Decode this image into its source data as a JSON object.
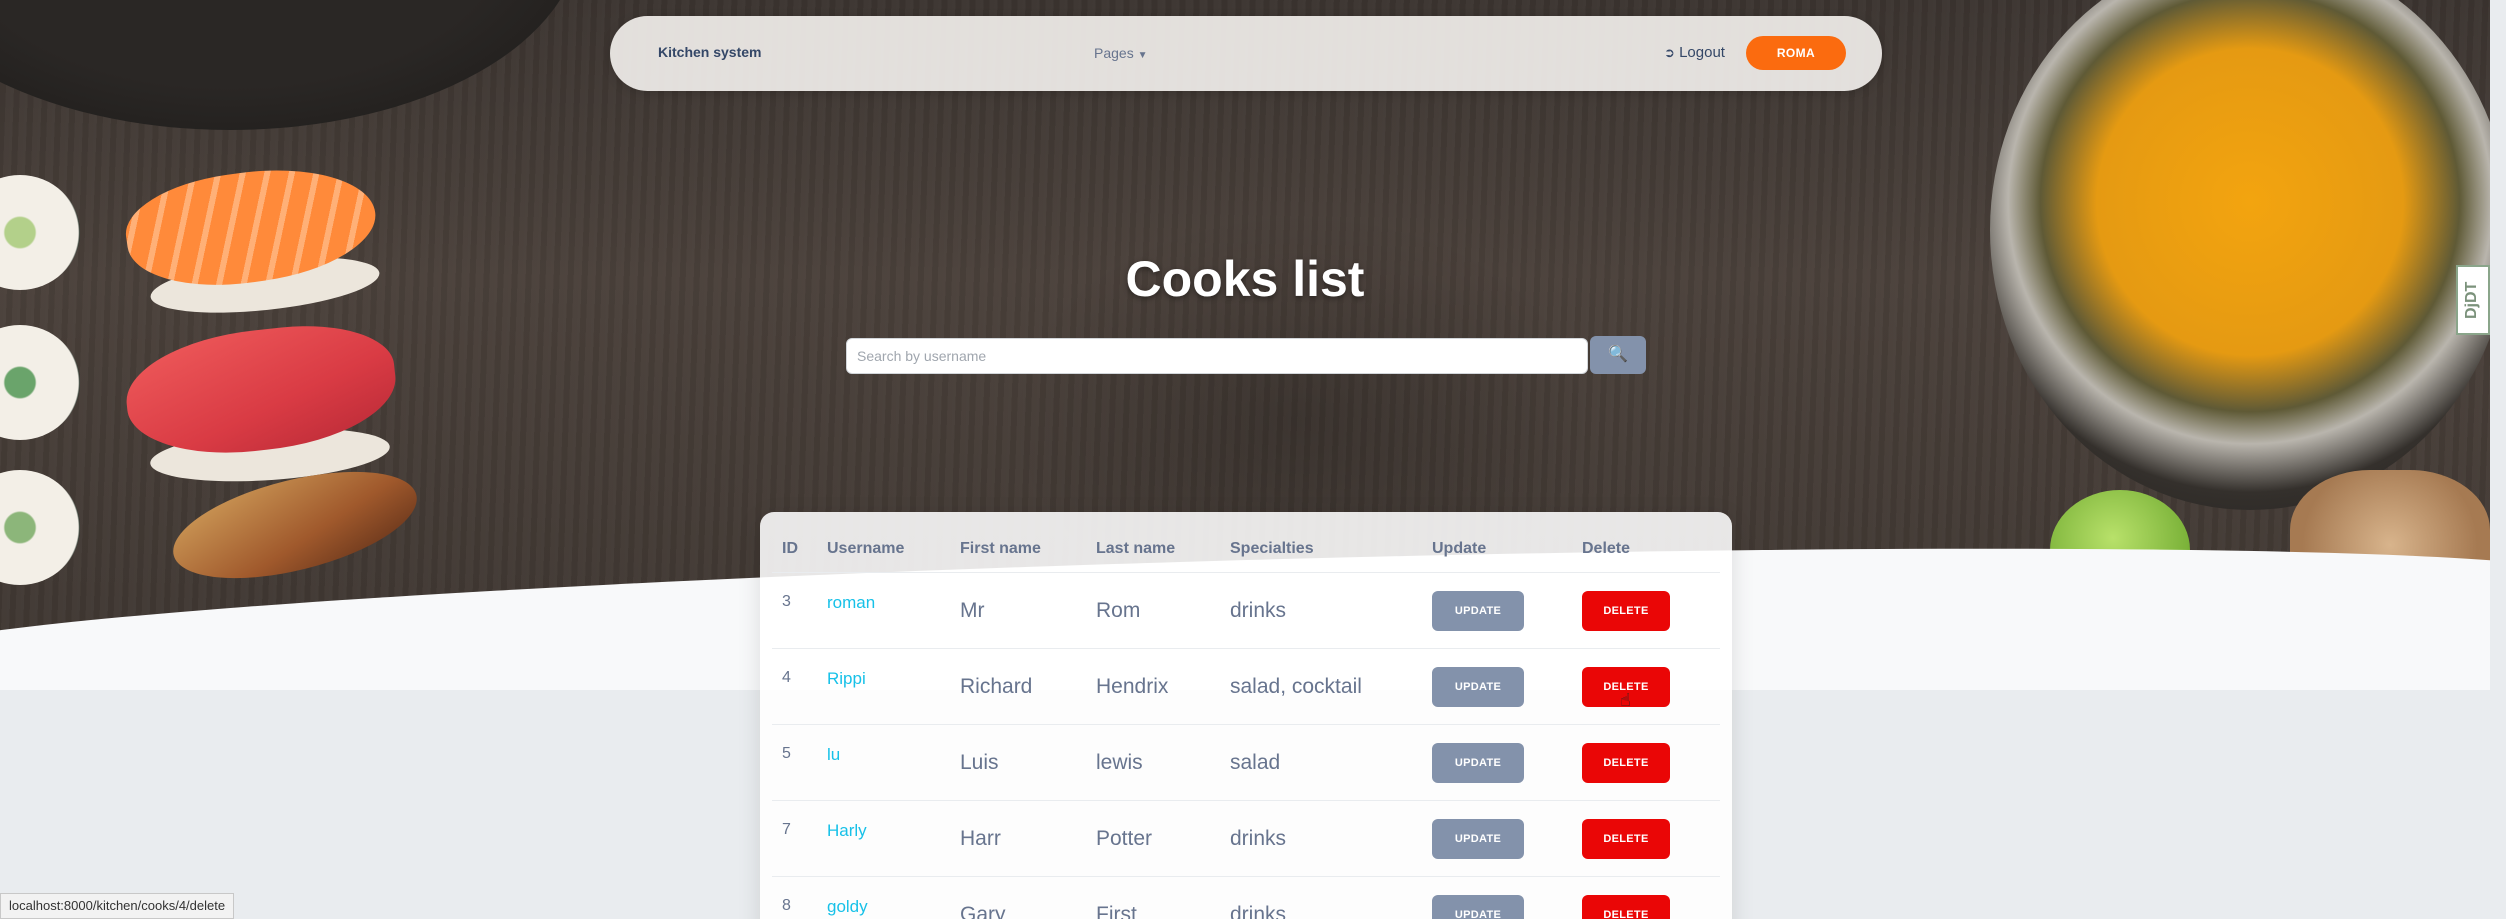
{
  "navbar": {
    "brand": "Kitchen system",
    "pages_label": "Pages",
    "logout_label": "Logout",
    "user_label": "ROMA",
    "accent_color": "#fb6b0f"
  },
  "page": {
    "title": "Cooks list",
    "search_placeholder": "Search by username",
    "search_icon": "magnifier-icon"
  },
  "table": {
    "headers": [
      "ID",
      "Username",
      "First name",
      "Last name",
      "Specialties",
      "Update",
      "Delete"
    ],
    "rows": [
      {
        "id": "3",
        "username": "roman",
        "first_name": "Mr",
        "last_name": "Rom",
        "specialties": "drinks",
        "update": "UPDATE",
        "delete": "DELETE"
      },
      {
        "id": "4",
        "username": "Rippi",
        "first_name": "Richard",
        "last_name": "Hendrix",
        "specialties": "salad, cocktail",
        "update": "UPDATE",
        "delete": "DELETE"
      },
      {
        "id": "5",
        "username": "lu",
        "first_name": "Luis",
        "last_name": "lewis",
        "specialties": "salad",
        "update": "UPDATE",
        "delete": "DELETE"
      },
      {
        "id": "7",
        "username": "Harly",
        "first_name": "Harr",
        "last_name": "Potter",
        "specialties": "drinks",
        "update": "UPDATE",
        "delete": "DELETE"
      },
      {
        "id": "8",
        "username": "goldy",
        "first_name": "Gary",
        "last_name": "First",
        "specialties": "drinks",
        "update": "UPDATE",
        "delete": "DELETE"
      }
    ],
    "update_color": "#8392ab",
    "delete_color": "#ea0606",
    "username_color": "#17c1e8"
  },
  "status_bar": {
    "url": "localhost:8000/kitchen/cooks/4/delete"
  },
  "debug_toolbar": {
    "label": "DjDT"
  }
}
